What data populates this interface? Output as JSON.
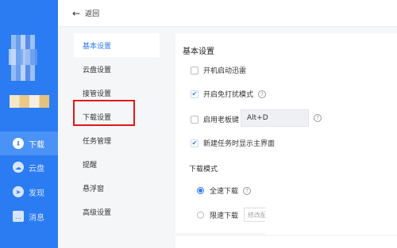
{
  "topbar": {
    "back_label": "返回"
  },
  "sidebar": {
    "items": [
      {
        "label": "下载",
        "icon": "download-icon",
        "active": true
      },
      {
        "label": "云盘",
        "icon": "cloud-icon",
        "active": false
      },
      {
        "label": "发现",
        "icon": "compass-icon",
        "active": false
      },
      {
        "label": "消息",
        "icon": "message-icon",
        "active": false
      }
    ]
  },
  "menu": {
    "items": [
      {
        "label": "基本设置"
      },
      {
        "label": "云盘设置"
      },
      {
        "label": "接管设置"
      },
      {
        "label": "下载设置"
      },
      {
        "label": "任务管理"
      },
      {
        "label": "提醒"
      },
      {
        "label": "悬浮窗"
      },
      {
        "label": "高级设置"
      }
    ]
  },
  "basic": {
    "title": "基本设置",
    "autostart": {
      "label": "开机启动迅雷",
      "checked": false
    },
    "nodisturb": {
      "label": "开启免打扰模式",
      "checked": true
    },
    "bosskey": {
      "label": "启用老板键",
      "checked": false,
      "value": "Alt+D"
    },
    "showmain": {
      "label": "新建任务时显示主界面",
      "checked": true
    }
  },
  "download_mode": {
    "title": "下载模式",
    "full": {
      "label": "全速下载",
      "selected": true
    },
    "limited": {
      "label": "限速下载",
      "selected": false,
      "placeholder": "修改配"
    }
  },
  "colors": {
    "accent": "#2b7cf2",
    "highlight": "#e0171c"
  }
}
